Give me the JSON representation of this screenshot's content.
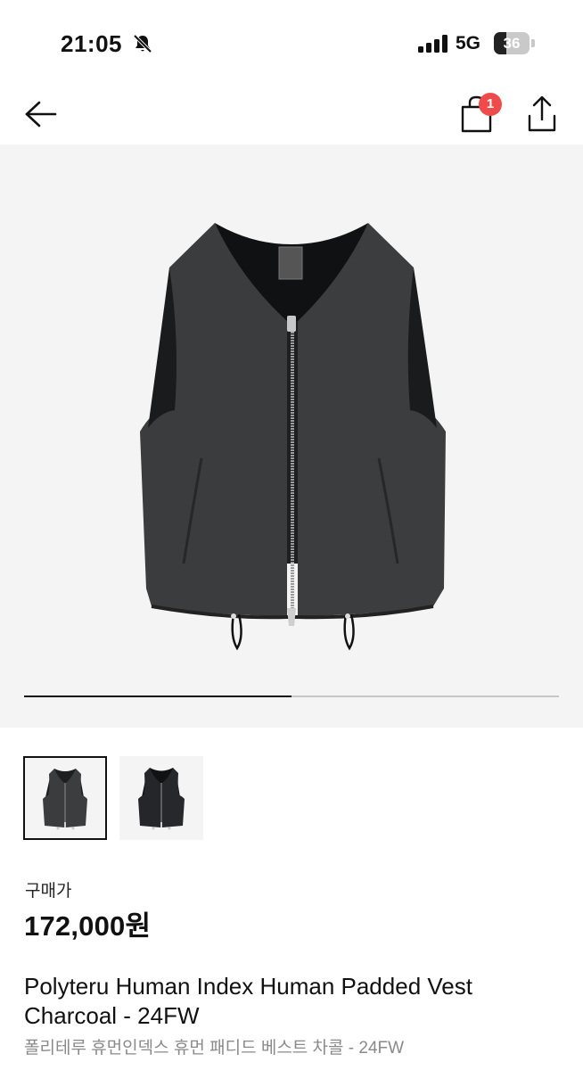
{
  "status_bar": {
    "time": "21:05",
    "network": "5G",
    "battery_level": "36",
    "battery_fraction": 0.36
  },
  "nav": {
    "back_icon": "arrow-left-icon",
    "cart_icon": "shopping-bag-icon",
    "cart_count": "1",
    "share_icon": "share-icon"
  },
  "gallery": {
    "image_count": 2,
    "current_index": 1,
    "progress_fraction": 0.5,
    "thumbnails": [
      {
        "selected": true
      },
      {
        "selected": false
      }
    ]
  },
  "product": {
    "price_label": "구매가",
    "price": "172,000원",
    "title": "Polyteru Human Index Human Padded Vest Charcoal - 24FW",
    "subtitle": "폴리테루 휴먼인덱스 휴먼 패디드 베스트 차콜 - 24FW"
  },
  "colors": {
    "badge": "#ef4b4b",
    "image_background": "#f4f4f4",
    "vest": "#3a3b3c",
    "subtitle": "#8a8a8a"
  }
}
